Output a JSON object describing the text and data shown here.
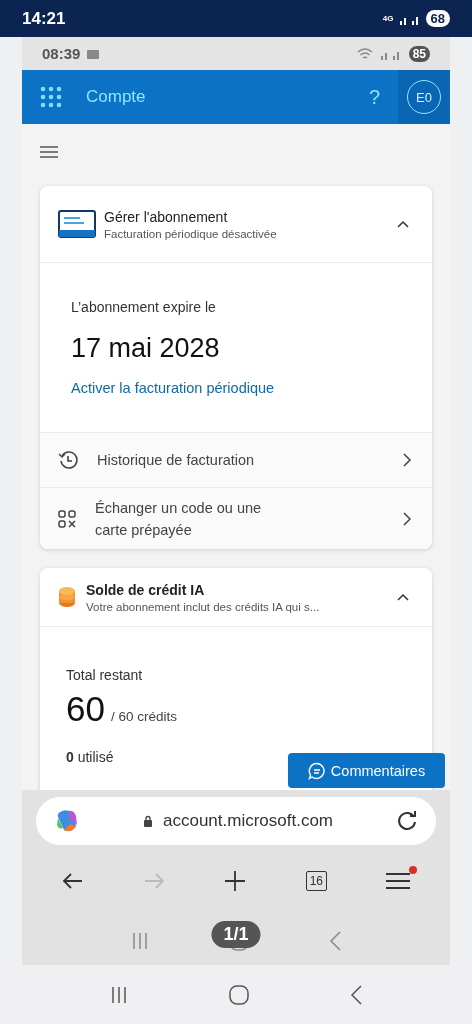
{
  "device_status": {
    "time": "14:21",
    "network": "4G",
    "battery": "68"
  },
  "app_status": {
    "time": "08:39",
    "battery": "85"
  },
  "header": {
    "title": "Compte",
    "help": "?",
    "avatar": "E0"
  },
  "subscription_card": {
    "title": "Gérer l'abonnement",
    "subtitle": "Facturation périodique désactivée",
    "expanded": true,
    "expiry_label": "L’abonnement expire le",
    "expiry_date": "17 mai 2028",
    "link": "Activer la facturation périodique",
    "links": [
      {
        "kind": "history",
        "label": "Historique de facturation"
      },
      {
        "kind": "code",
        "label": "Échanger un code ou une carte prépayée"
      }
    ]
  },
  "credit_card": {
    "title": "Solde de crédit IA",
    "subtitle": "Votre abonnement inclut des crédits IA qui s...",
    "expanded": true,
    "total_label": "Total restant",
    "total": "60",
    "total_of": "/ 60 crédits",
    "used": "**0** utilisé"
  },
  "feedback_button": "Commentaires",
  "browser": {
    "url": "account.microsoft.com",
    "tab_count": "16",
    "menu_badge": true,
    "forward_disabled": true
  },
  "page_counter": "1/1"
}
